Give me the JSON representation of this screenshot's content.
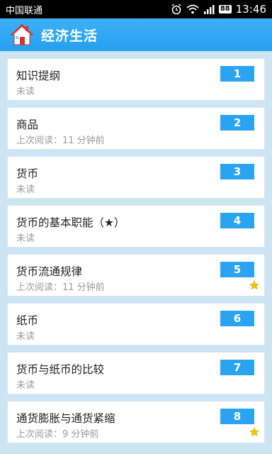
{
  "status_bar": {
    "carrier": "中国联通",
    "battery": "88",
    "time": "13:46"
  },
  "app_bar": {
    "title": "经济生活",
    "icon": "house-icon"
  },
  "items": [
    {
      "title": "知识提纲",
      "status": "未读",
      "number": "1",
      "starred": false
    },
    {
      "title": "商品",
      "status": "上次阅读：11 分钟前",
      "number": "2",
      "starred": false
    },
    {
      "title": "货币",
      "status": "未读",
      "number": "3",
      "starred": false
    },
    {
      "title": "货币的基本职能（★）",
      "status": "未读",
      "number": "4",
      "starred": false
    },
    {
      "title": "货币流通规律",
      "status": "上次阅读：11 分钟前",
      "number": "5",
      "starred": true
    },
    {
      "title": "纸币",
      "status": "未读",
      "number": "6",
      "starred": false
    },
    {
      "title": "货币与纸币的比较",
      "status": "未读",
      "number": "7",
      "starred": false
    },
    {
      "title": "通货膨胀与通货紧缩",
      "status": "上次阅读：9 分钟前",
      "number": "8",
      "starred": true
    }
  ],
  "colors": {
    "accent": "#2aa4f1",
    "star": "#f5c400"
  }
}
